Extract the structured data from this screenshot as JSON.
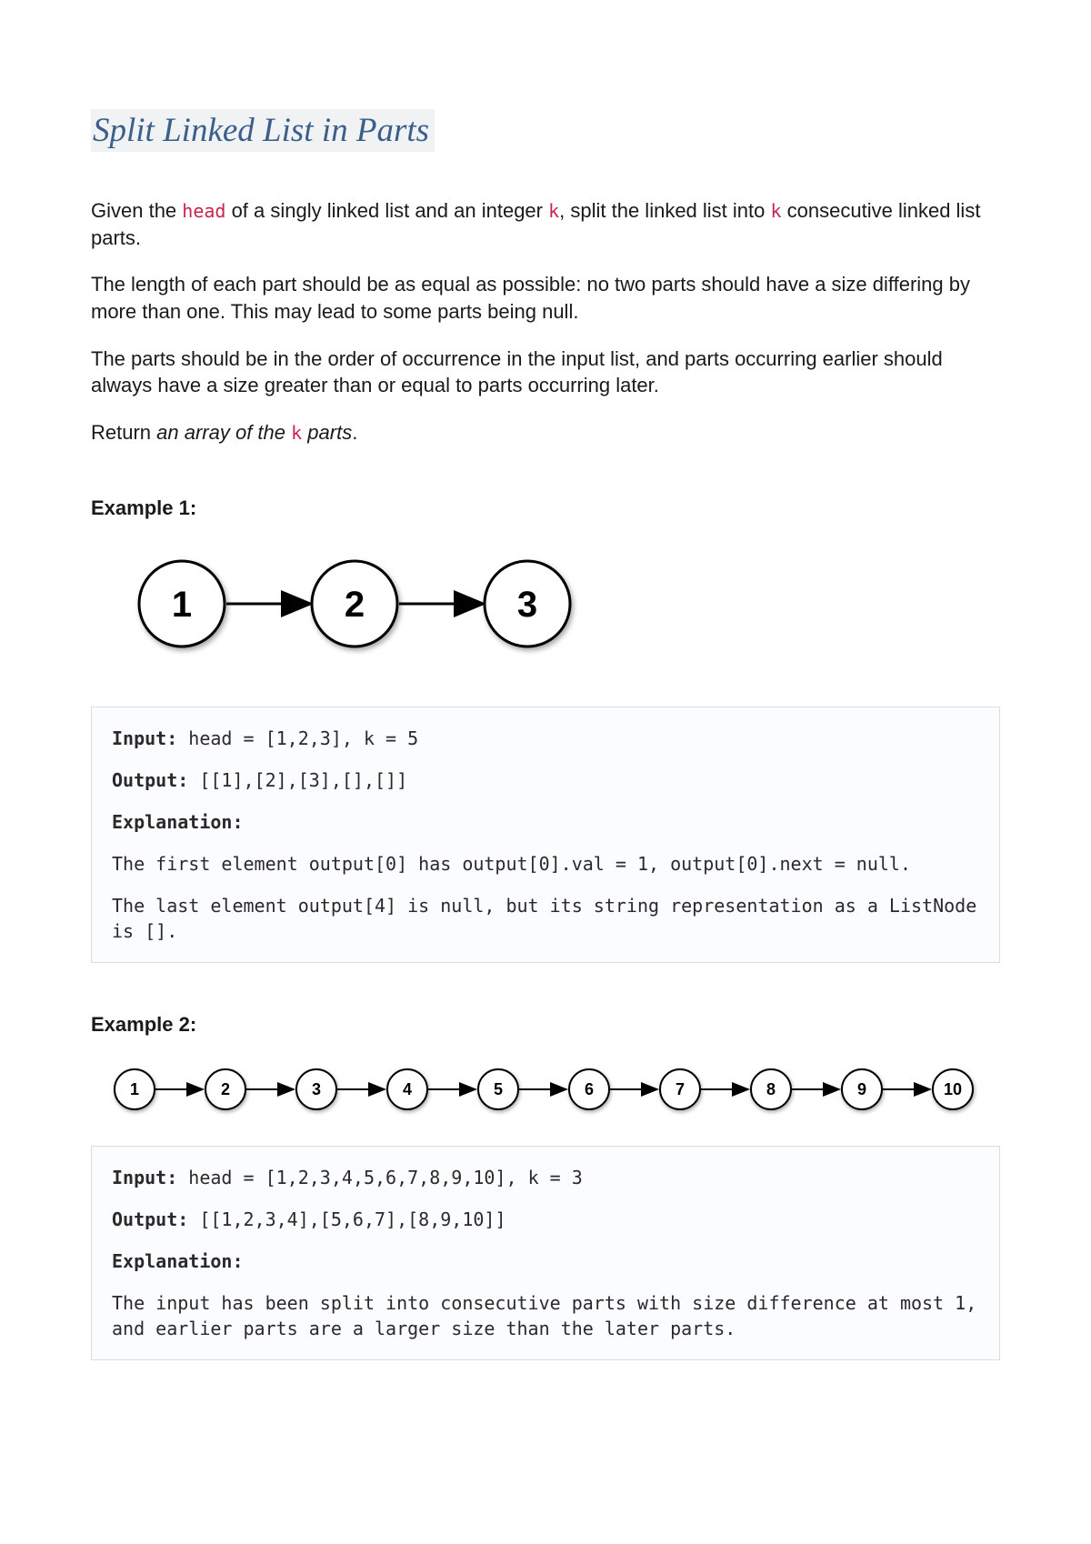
{
  "title": "Split Linked List in Parts",
  "p1_a": "Given the ",
  "p1_head": "head",
  "p1_b": " of a singly linked list and an integer ",
  "p1_k": "k",
  "p1_c": ", split the linked list into ",
  "p1_k2": "k",
  "p1_d": " consecutive linked list parts.",
  "p2": "The length of each part should be as equal as possible: no two parts should have a size differing by more than one. This may lead to some parts being null.",
  "p3": "The parts should be in the order of occurrence in the input list, and parts occurring earlier should always have a size greater than or equal to parts occurring later.",
  "p4_a": "Return ",
  "p4_b": "an array of the ",
  "p4_k": "k",
  "p4_c": " parts",
  "p4_d": ".",
  "ex1_heading": "Example 1:",
  "ex1_nodes": [
    "1",
    "2",
    "3"
  ],
  "ex1_input_label": "Input:",
  "ex1_input_val": " head = [1,2,3], k = 5",
  "ex1_output_label": "Output:",
  "ex1_output_val": " [[1],[2],[3],[],[]]",
  "ex1_expl_label": "Explanation:",
  "ex1_expl_1": "The first element output[0] has output[0].val = 1, output[0].next = null.",
  "ex1_expl_2": "The last element output[4] is null, but its string representation as a ListNode is [].",
  "ex2_heading": "Example 2:",
  "ex2_nodes": [
    "1",
    "2",
    "3",
    "4",
    "5",
    "6",
    "7",
    "8",
    "9",
    "10"
  ],
  "ex2_input_label": "Input:",
  "ex2_input_val": " head = [1,2,3,4,5,6,7,8,9,10], k = 3",
  "ex2_output_label": "Output:",
  "ex2_output_val": " [[1,2,3,4],[5,6,7],[8,9,10]]",
  "ex2_expl_label": "Explanation:",
  "ex2_expl_1": "The input has been split into consecutive parts with size difference at most 1, and earlier parts are a larger size than the later parts."
}
